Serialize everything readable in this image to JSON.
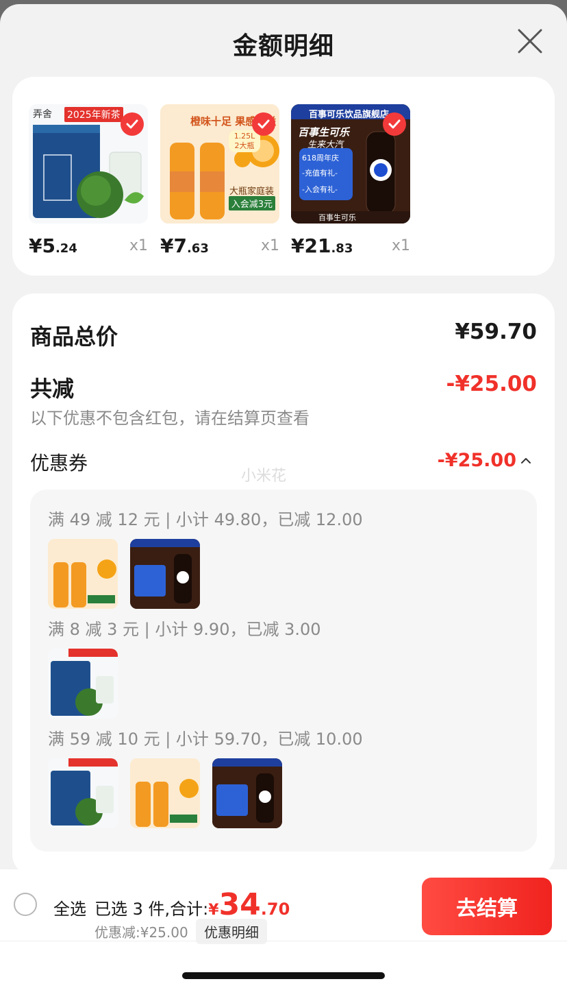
{
  "header": {
    "title": "金额明细"
  },
  "products": [
    {
      "yen": "¥",
      "price_int": "5",
      "price_dec": ".24",
      "qty": "x1",
      "badge": "2025年新茶",
      "brand": "弄舍",
      "name": "tea"
    },
    {
      "yen": "¥",
      "price_int": "7",
      "price_dec": ".63",
      "qty": "x1",
      "headline": "橙味十足 果感满溢",
      "size": "1.25L 2大瓶",
      "tag1": "大瓶家庭装",
      "tag2": "入会减3元",
      "name": "orange"
    },
    {
      "yen": "¥",
      "price_int": "21",
      "price_dec": ".83",
      "qty": "x1",
      "banner": "百事可乐饮品旗舰店",
      "headline": "百事生可乐",
      "sub": "生来大汽",
      "promo1": "618周年庆",
      "promo2": "-充值有礼-",
      "promo3": "-入会有礼-",
      "logo": "百事可乐",
      "footer": "百事生可乐",
      "name": "cola"
    }
  ],
  "summary": {
    "total_label": "商品总价",
    "total_value": "¥59.70",
    "reduce_label": "共减",
    "reduce_value": "-¥25.00",
    "note": "以下优惠不包含红包，请在结算页查看",
    "coupon_label": "优惠券",
    "coupon_value": "-¥25.00",
    "watermark": "小米花"
  },
  "coupon_groups": [
    {
      "title": "满 49 减 12 元 | 小计 49.80，已减 12.00",
      "items": [
        "orange",
        "cola"
      ]
    },
    {
      "title": "满 8 减 3 元 | 小计 9.90，已减 3.00",
      "items": [
        "tea"
      ]
    },
    {
      "title": "满 59 减 10 元 | 小计 59.70，已减 10.00",
      "items": [
        "tea",
        "orange",
        "cola"
      ]
    }
  ],
  "footer": {
    "select_all": "全选",
    "selected_text": "已选 3 件,合计:",
    "yen": "¥",
    "total_int": "34",
    "total_dec": ".70",
    "discount": "优惠减:¥25.00",
    "detail_btn": "优惠明细",
    "checkout": "去结算"
  },
  "colors": {
    "accent": "#f0312a",
    "tea_blue": "#1e4f8c",
    "orange": "#f39a22",
    "cola_dark": "#2a160e"
  }
}
